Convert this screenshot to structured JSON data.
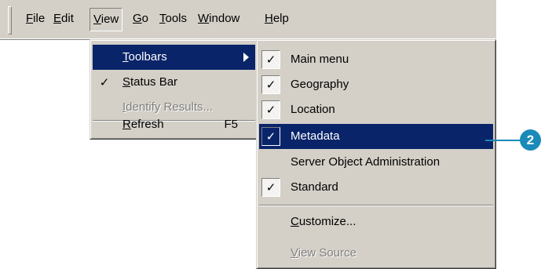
{
  "menubar": {
    "items": [
      {
        "pre": "",
        "u": "F",
        "post": "ile"
      },
      {
        "pre": "",
        "u": "E",
        "post": "dit"
      },
      {
        "pre": "",
        "u": "V",
        "post": "iew"
      },
      {
        "pre": "",
        "u": "G",
        "post": "o"
      },
      {
        "pre": "",
        "u": "T",
        "post": "ools"
      },
      {
        "pre": "",
        "u": "W",
        "post": "indow"
      },
      {
        "pre": "",
        "u": "H",
        "post": "elp"
      }
    ]
  },
  "view_menu": {
    "toolbars": {
      "pre": "",
      "u": "T",
      "post": "oolbars"
    },
    "status_bar": {
      "pre": "",
      "u": "S",
      "post": "tatus Bar",
      "checked": "✓"
    },
    "identify_results": {
      "pre": "",
      "u": "I",
      "post": "dentify Results..."
    },
    "refresh": {
      "pre": "",
      "u": "R",
      "post": "efresh",
      "shortcut": "F5"
    }
  },
  "toolbars_menu": {
    "items": [
      {
        "label": "Main menu",
        "check": "✓"
      },
      {
        "label": "Geography",
        "check": "✓"
      },
      {
        "label": "Location",
        "check": "✓"
      },
      {
        "label": "Metadata",
        "check": "✓"
      },
      {
        "label": "Server Object Administration",
        "check": ""
      },
      {
        "label": "Standard",
        "check": "✓"
      }
    ],
    "customize": {
      "pre": "",
      "u": "C",
      "post": "ustomize..."
    },
    "view_source": {
      "pre": "",
      "u": "V",
      "post": "iew Source"
    }
  },
  "callout": {
    "number": "2",
    "color": "#1a8ab8"
  }
}
